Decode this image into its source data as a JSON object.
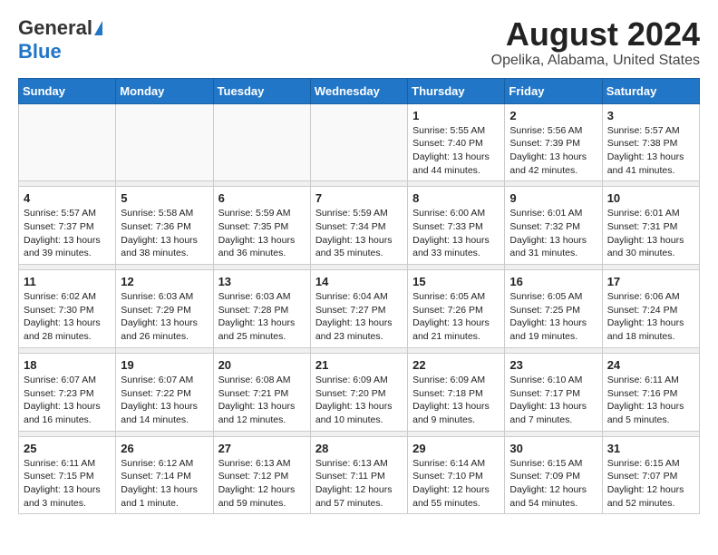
{
  "logo": {
    "general": "General",
    "blue": "Blue"
  },
  "title": "August 2024",
  "subtitle": "Opelika, Alabama, United States",
  "weekdays": [
    "Sunday",
    "Monday",
    "Tuesday",
    "Wednesday",
    "Thursday",
    "Friday",
    "Saturday"
  ],
  "weeks": [
    [
      {
        "day": "",
        "sunrise": "",
        "sunset": "",
        "daylight": ""
      },
      {
        "day": "",
        "sunrise": "",
        "sunset": "",
        "daylight": ""
      },
      {
        "day": "",
        "sunrise": "",
        "sunset": "",
        "daylight": ""
      },
      {
        "day": "",
        "sunrise": "",
        "sunset": "",
        "daylight": ""
      },
      {
        "day": "1",
        "sunrise": "Sunrise: 5:55 AM",
        "sunset": "Sunset: 7:40 PM",
        "daylight": "Daylight: 13 hours and 44 minutes."
      },
      {
        "day": "2",
        "sunrise": "Sunrise: 5:56 AM",
        "sunset": "Sunset: 7:39 PM",
        "daylight": "Daylight: 13 hours and 42 minutes."
      },
      {
        "day": "3",
        "sunrise": "Sunrise: 5:57 AM",
        "sunset": "Sunset: 7:38 PM",
        "daylight": "Daylight: 13 hours and 41 minutes."
      }
    ],
    [
      {
        "day": "4",
        "sunrise": "Sunrise: 5:57 AM",
        "sunset": "Sunset: 7:37 PM",
        "daylight": "Daylight: 13 hours and 39 minutes."
      },
      {
        "day": "5",
        "sunrise": "Sunrise: 5:58 AM",
        "sunset": "Sunset: 7:36 PM",
        "daylight": "Daylight: 13 hours and 38 minutes."
      },
      {
        "day": "6",
        "sunrise": "Sunrise: 5:59 AM",
        "sunset": "Sunset: 7:35 PM",
        "daylight": "Daylight: 13 hours and 36 minutes."
      },
      {
        "day": "7",
        "sunrise": "Sunrise: 5:59 AM",
        "sunset": "Sunset: 7:34 PM",
        "daylight": "Daylight: 13 hours and 35 minutes."
      },
      {
        "day": "8",
        "sunrise": "Sunrise: 6:00 AM",
        "sunset": "Sunset: 7:33 PM",
        "daylight": "Daylight: 13 hours and 33 minutes."
      },
      {
        "day": "9",
        "sunrise": "Sunrise: 6:01 AM",
        "sunset": "Sunset: 7:32 PM",
        "daylight": "Daylight: 13 hours and 31 minutes."
      },
      {
        "day": "10",
        "sunrise": "Sunrise: 6:01 AM",
        "sunset": "Sunset: 7:31 PM",
        "daylight": "Daylight: 13 hours and 30 minutes."
      }
    ],
    [
      {
        "day": "11",
        "sunrise": "Sunrise: 6:02 AM",
        "sunset": "Sunset: 7:30 PM",
        "daylight": "Daylight: 13 hours and 28 minutes."
      },
      {
        "day": "12",
        "sunrise": "Sunrise: 6:03 AM",
        "sunset": "Sunset: 7:29 PM",
        "daylight": "Daylight: 13 hours and 26 minutes."
      },
      {
        "day": "13",
        "sunrise": "Sunrise: 6:03 AM",
        "sunset": "Sunset: 7:28 PM",
        "daylight": "Daylight: 13 hours and 25 minutes."
      },
      {
        "day": "14",
        "sunrise": "Sunrise: 6:04 AM",
        "sunset": "Sunset: 7:27 PM",
        "daylight": "Daylight: 13 hours and 23 minutes."
      },
      {
        "day": "15",
        "sunrise": "Sunrise: 6:05 AM",
        "sunset": "Sunset: 7:26 PM",
        "daylight": "Daylight: 13 hours and 21 minutes."
      },
      {
        "day": "16",
        "sunrise": "Sunrise: 6:05 AM",
        "sunset": "Sunset: 7:25 PM",
        "daylight": "Daylight: 13 hours and 19 minutes."
      },
      {
        "day": "17",
        "sunrise": "Sunrise: 6:06 AM",
        "sunset": "Sunset: 7:24 PM",
        "daylight": "Daylight: 13 hours and 18 minutes."
      }
    ],
    [
      {
        "day": "18",
        "sunrise": "Sunrise: 6:07 AM",
        "sunset": "Sunset: 7:23 PM",
        "daylight": "Daylight: 13 hours and 16 minutes."
      },
      {
        "day": "19",
        "sunrise": "Sunrise: 6:07 AM",
        "sunset": "Sunset: 7:22 PM",
        "daylight": "Daylight: 13 hours and 14 minutes."
      },
      {
        "day": "20",
        "sunrise": "Sunrise: 6:08 AM",
        "sunset": "Sunset: 7:21 PM",
        "daylight": "Daylight: 13 hours and 12 minutes."
      },
      {
        "day": "21",
        "sunrise": "Sunrise: 6:09 AM",
        "sunset": "Sunset: 7:20 PM",
        "daylight": "Daylight: 13 hours and 10 minutes."
      },
      {
        "day": "22",
        "sunrise": "Sunrise: 6:09 AM",
        "sunset": "Sunset: 7:18 PM",
        "daylight": "Daylight: 13 hours and 9 minutes."
      },
      {
        "day": "23",
        "sunrise": "Sunrise: 6:10 AM",
        "sunset": "Sunset: 7:17 PM",
        "daylight": "Daylight: 13 hours and 7 minutes."
      },
      {
        "day": "24",
        "sunrise": "Sunrise: 6:11 AM",
        "sunset": "Sunset: 7:16 PM",
        "daylight": "Daylight: 13 hours and 5 minutes."
      }
    ],
    [
      {
        "day": "25",
        "sunrise": "Sunrise: 6:11 AM",
        "sunset": "Sunset: 7:15 PM",
        "daylight": "Daylight: 13 hours and 3 minutes."
      },
      {
        "day": "26",
        "sunrise": "Sunrise: 6:12 AM",
        "sunset": "Sunset: 7:14 PM",
        "daylight": "Daylight: 13 hours and 1 minute."
      },
      {
        "day": "27",
        "sunrise": "Sunrise: 6:13 AM",
        "sunset": "Sunset: 7:12 PM",
        "daylight": "Daylight: 12 hours and 59 minutes."
      },
      {
        "day": "28",
        "sunrise": "Sunrise: 6:13 AM",
        "sunset": "Sunset: 7:11 PM",
        "daylight": "Daylight: 12 hours and 57 minutes."
      },
      {
        "day": "29",
        "sunrise": "Sunrise: 6:14 AM",
        "sunset": "Sunset: 7:10 PM",
        "daylight": "Daylight: 12 hours and 55 minutes."
      },
      {
        "day": "30",
        "sunrise": "Sunrise: 6:15 AM",
        "sunset": "Sunset: 7:09 PM",
        "daylight": "Daylight: 12 hours and 54 minutes."
      },
      {
        "day": "31",
        "sunrise": "Sunrise: 6:15 AM",
        "sunset": "Sunset: 7:07 PM",
        "daylight": "Daylight: 12 hours and 52 minutes."
      }
    ]
  ]
}
